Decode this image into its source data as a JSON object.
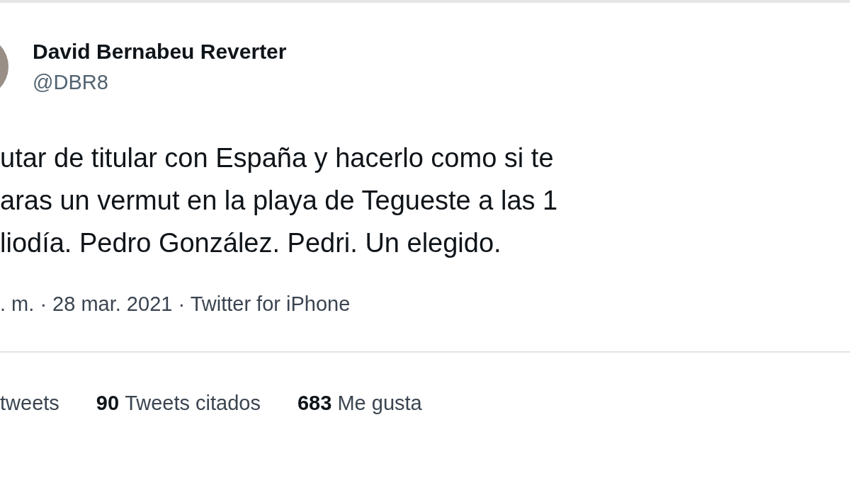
{
  "author": {
    "name": "David Bernabeu Reverter",
    "handle": "@DBR8"
  },
  "tweet": {
    "lines": [
      "utar de titular con España y hacerlo como si te",
      "aras un vermut en la playa de Tegueste a las 1",
      "liodía. Pedro González. Pedri. Un elegido."
    ]
  },
  "meta": ". m. · 28 mar. 2021 · Twitter for iPhone",
  "stats": [
    {
      "label": "tweets"
    },
    {
      "count": "90",
      "label": "Tweets citados"
    },
    {
      "count": "683",
      "label": "Me gusta"
    }
  ]
}
